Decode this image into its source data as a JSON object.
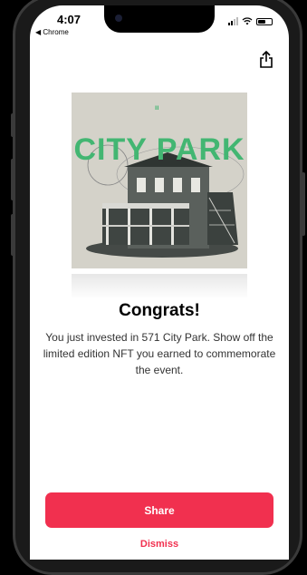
{
  "status_bar": {
    "time": "4:07",
    "back_label": "◀ Chrome"
  },
  "nft": {
    "title": "CITY PARK",
    "small_mark": "ıı"
  },
  "modal": {
    "heading": "Congrats!",
    "message": "You just invested in 571 City Park. Show off the limited edition NFT you earned to commemorate the event.",
    "share_label": "Share",
    "dismiss_label": "Dismiss"
  },
  "colors": {
    "accent": "#f1304f",
    "nft_green": "#43b672"
  },
  "icons": [
    "share-icon",
    "signal-icon",
    "wifi-icon",
    "battery-icon"
  ]
}
